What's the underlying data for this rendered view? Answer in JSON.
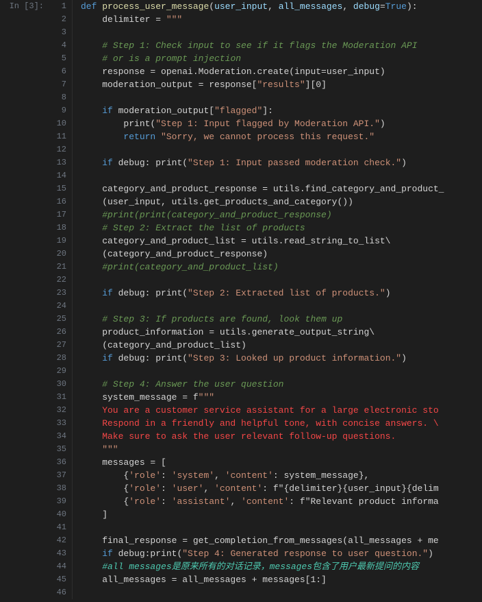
{
  "cell_label": "In [3]:",
  "lines": [
    {
      "num": 1,
      "tokens": [
        {
          "t": "kw",
          "v": "def "
        },
        {
          "t": "fn",
          "v": "process_user_message"
        },
        {
          "t": "default-text",
          "v": "("
        },
        {
          "t": "param",
          "v": "user_input"
        },
        {
          "t": "default-text",
          "v": ", "
        },
        {
          "t": "param",
          "v": "all_messages"
        },
        {
          "t": "default-text",
          "v": ", "
        },
        {
          "t": "param",
          "v": "debug"
        },
        {
          "t": "default-text",
          "v": "="
        },
        {
          "t": "bool",
          "v": "True"
        },
        {
          "t": "default-text",
          "v": "):"
        }
      ]
    },
    {
      "num": 2,
      "tokens": [
        {
          "t": "default-text",
          "v": "    delimiter = "
        },
        {
          "t": "str",
          "v": "\"\"\""
        }
      ]
    },
    {
      "num": 3,
      "tokens": []
    },
    {
      "num": 4,
      "tokens": [
        {
          "t": "default-text",
          "v": "    "
        },
        {
          "t": "comment",
          "v": "# Step 1: Check input to see if it flags the Moderation API"
        }
      ]
    },
    {
      "num": 5,
      "tokens": [
        {
          "t": "default-text",
          "v": "    "
        },
        {
          "t": "comment",
          "v": "# or is a prompt injection"
        }
      ]
    },
    {
      "num": 6,
      "tokens": [
        {
          "t": "default-text",
          "v": "    response = openai.Moderation.create(input=user_input)"
        }
      ]
    },
    {
      "num": 7,
      "tokens": [
        {
          "t": "default-text",
          "v": "    moderation_output = response["
        },
        {
          "t": "str",
          "v": "\"results\""
        },
        {
          "t": "default-text",
          "v": "][0]"
        }
      ]
    },
    {
      "num": 8,
      "tokens": []
    },
    {
      "num": 9,
      "tokens": [
        {
          "t": "default-text",
          "v": "    "
        },
        {
          "t": "kw",
          "v": "if "
        },
        {
          "t": "default-text",
          "v": "moderation_output["
        },
        {
          "t": "str",
          "v": "\"flagged\""
        },
        {
          "t": "default-text",
          "v": "]:"
        }
      ]
    },
    {
      "num": 10,
      "tokens": [
        {
          "t": "default-text",
          "v": "        print("
        },
        {
          "t": "str",
          "v": "\"Step 1: Input flagged by Moderation API.\""
        },
        {
          "t": "default-text",
          "v": ")"
        }
      ]
    },
    {
      "num": 11,
      "tokens": [
        {
          "t": "default-text",
          "v": "        "
        },
        {
          "t": "kw",
          "v": "return "
        },
        {
          "t": "str",
          "v": "\"Sorry, we cannot process this request.\""
        }
      ]
    },
    {
      "num": 12,
      "tokens": []
    },
    {
      "num": 13,
      "tokens": [
        {
          "t": "default-text",
          "v": "    "
        },
        {
          "t": "kw",
          "v": "if "
        },
        {
          "t": "default-text",
          "v": "debug: print("
        },
        {
          "t": "str",
          "v": "\"Step 1: Input passed moderation check.\""
        },
        {
          "t": "default-text",
          "v": ")"
        }
      ]
    },
    {
      "num": 14,
      "tokens": []
    },
    {
      "num": 15,
      "tokens": [
        {
          "t": "default-text",
          "v": "    category_and_product_response = utils.find_category_and_product_"
        }
      ]
    },
    {
      "num": 16,
      "tokens": [
        {
          "t": "default-text",
          "v": "    (user_input, utils.get_products_and_category())"
        }
      ]
    },
    {
      "num": 17,
      "tokens": [
        {
          "t": "comment",
          "v": "    #print(print(category_and_product_response)"
        }
      ]
    },
    {
      "num": 18,
      "tokens": [
        {
          "t": "default-text",
          "v": "    "
        },
        {
          "t": "comment",
          "v": "# Step 2: Extract the list of products"
        }
      ]
    },
    {
      "num": 19,
      "tokens": [
        {
          "t": "default-text",
          "v": "    category_and_product_list = utils.read_string_to_list\\"
        }
      ]
    },
    {
      "num": 20,
      "tokens": [
        {
          "t": "default-text",
          "v": "    (category_and_product_response)"
        }
      ]
    },
    {
      "num": 21,
      "tokens": [
        {
          "t": "comment",
          "v": "    #print(category_and_product_list)"
        }
      ]
    },
    {
      "num": 22,
      "tokens": []
    },
    {
      "num": 23,
      "tokens": [
        {
          "t": "default-text",
          "v": "    "
        },
        {
          "t": "kw",
          "v": "if "
        },
        {
          "t": "default-text",
          "v": "debug: print("
        },
        {
          "t": "str",
          "v": "\"Step 2: Extracted list of products.\""
        },
        {
          "t": "default-text",
          "v": ")"
        }
      ]
    },
    {
      "num": 24,
      "tokens": []
    },
    {
      "num": 25,
      "tokens": [
        {
          "t": "default-text",
          "v": "    "
        },
        {
          "t": "comment",
          "v": "# Step 3: If products are found, look them up"
        }
      ]
    },
    {
      "num": 26,
      "tokens": [
        {
          "t": "default-text",
          "v": "    product_information = utils.generate_output_string\\"
        }
      ]
    },
    {
      "num": 27,
      "tokens": [
        {
          "t": "default-text",
          "v": "    (category_and_product_list)"
        }
      ]
    },
    {
      "num": 28,
      "tokens": [
        {
          "t": "default-text",
          "v": "    "
        },
        {
          "t": "kw",
          "v": "if "
        },
        {
          "t": "default-text",
          "v": "debug: print("
        },
        {
          "t": "str",
          "v": "\"Step 3: Looked up product information.\""
        },
        {
          "t": "default-text",
          "v": ")"
        }
      ]
    },
    {
      "num": 29,
      "tokens": []
    },
    {
      "num": 30,
      "tokens": [
        {
          "t": "default-text",
          "v": "    "
        },
        {
          "t": "comment",
          "v": "# Step 4: Answer the user question"
        }
      ]
    },
    {
      "num": 31,
      "tokens": [
        {
          "t": "default-text",
          "v": "    system_message = f"
        },
        {
          "t": "str",
          "v": "\"\"\""
        }
      ]
    },
    {
      "num": 32,
      "tokens": [
        {
          "t": "red-text",
          "v": "    You are a customer service assistant for a large electronic sto"
        }
      ]
    },
    {
      "num": 33,
      "tokens": [
        {
          "t": "red-text",
          "v": "    Respond in a friendly and helpful tone, with concise answers. \\"
        }
      ]
    },
    {
      "num": 34,
      "tokens": [
        {
          "t": "red-text",
          "v": "    Make sure to ask the user relevant follow-up questions."
        }
      ]
    },
    {
      "num": 35,
      "tokens": [
        {
          "t": "str",
          "v": "    \"\"\""
        }
      ]
    },
    {
      "num": 36,
      "tokens": [
        {
          "t": "default-text",
          "v": "    messages = ["
        }
      ]
    },
    {
      "num": 37,
      "tokens": [
        {
          "t": "default-text",
          "v": "        {"
        },
        {
          "t": "str",
          "v": "'role'"
        },
        {
          "t": "default-text",
          "v": ": "
        },
        {
          "t": "str",
          "v": "'system'"
        },
        {
          "t": "default-text",
          "v": ", "
        },
        {
          "t": "str",
          "v": "'content'"
        },
        {
          "t": "default-text",
          "v": ": system_message},"
        }
      ]
    },
    {
      "num": 38,
      "tokens": [
        {
          "t": "default-text",
          "v": "        {"
        },
        {
          "t": "str",
          "v": "'role'"
        },
        {
          "t": "default-text",
          "v": ": "
        },
        {
          "t": "str",
          "v": "'user'"
        },
        {
          "t": "default-text",
          "v": ", "
        },
        {
          "t": "str",
          "v": "'content'"
        },
        {
          "t": "default-text",
          "v": ": f\"{delimiter}{user_input}{delim"
        }
      ]
    },
    {
      "num": 39,
      "tokens": [
        {
          "t": "default-text",
          "v": "        {"
        },
        {
          "t": "str",
          "v": "'role'"
        },
        {
          "t": "default-text",
          "v": ": "
        },
        {
          "t": "str",
          "v": "'assistant'"
        },
        {
          "t": "default-text",
          "v": ", "
        },
        {
          "t": "str",
          "v": "'content'"
        },
        {
          "t": "default-text",
          "v": ": f\"Relevant product informa"
        }
      ]
    },
    {
      "num": 40,
      "tokens": [
        {
          "t": "default-text",
          "v": "    ]"
        }
      ]
    },
    {
      "num": 41,
      "tokens": []
    },
    {
      "num": 42,
      "tokens": [
        {
          "t": "default-text",
          "v": "    final_response = get_completion_from_messages(all_messages + me"
        }
      ]
    },
    {
      "num": 43,
      "tokens": [
        {
          "t": "default-text",
          "v": "    "
        },
        {
          "t": "kw",
          "v": "if "
        },
        {
          "t": "default-text",
          "v": "debug:print("
        },
        {
          "t": "str",
          "v": "\"Step 4: Generated response to user question.\""
        },
        {
          "t": "default-text",
          "v": ")"
        }
      ]
    },
    {
      "num": 44,
      "tokens": [
        {
          "t": "cyan-comment",
          "v": "    #all messages是原来所有的对话记录，messages包含了用户最新提问的内容"
        }
      ]
    },
    {
      "num": 45,
      "tokens": [
        {
          "t": "default-text",
          "v": "    all_messages = all_messages + messages[1:]"
        }
      ]
    },
    {
      "num": 46,
      "tokens": []
    }
  ]
}
